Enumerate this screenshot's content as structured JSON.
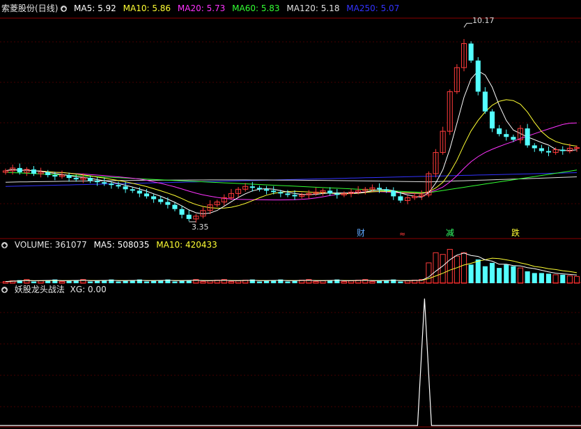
{
  "colors": {
    "bg": "#000000",
    "up": "#ff3b3b",
    "down": "#54ffff",
    "ma5": "#ffffff",
    "ma10": "#ffff33",
    "ma20": "#ff33ff",
    "ma60": "#33ff33",
    "ma120": "#e0e0e0",
    "ma250": "#3333ff",
    "grid": "#8b0000"
  },
  "price_panel": {
    "stock_name": "索菱股份",
    "period": "(日线)",
    "ma": [
      {
        "label": "MA5: 5.92",
        "color": "#ffffff"
      },
      {
        "label": "MA10: 5.86",
        "color": "#ffff33"
      },
      {
        "label": "MA20: 5.73",
        "color": "#ff33ff"
      },
      {
        "label": "MA60: 5.83",
        "color": "#33ff33"
      },
      {
        "label": "MA120: 5.18",
        "color": "#e0e0e0"
      },
      {
        "label": "MA250: 5.07",
        "color": "#3333ff"
      }
    ],
    "high_label": "10.17",
    "low_label": "3.35",
    "markers": [
      {
        "text": "财",
        "color": "#5fa8ff"
      },
      {
        "text": "≈",
        "color": "#ff3b3b"
      },
      {
        "text": "减",
        "color": "#33ff66"
      },
      {
        "text": "跌",
        "color": "#ffff33"
      }
    ]
  },
  "volume_panel": {
    "title": "VOLUME: 361077",
    "ma5": "MA5: 508035",
    "ma10": "MA10: 420433"
  },
  "indicator_panel": {
    "title": "妖股龙头战法",
    "value": "XG: 0.00"
  },
  "chart_data": {
    "type": "candlestick",
    "price_range": [
      3.35,
      10.17
    ],
    "closes": [
      5.1,
      5.2,
      5.05,
      5.15,
      5.0,
      5.05,
      4.95,
      4.9,
      4.95,
      4.85,
      4.8,
      4.85,
      4.75,
      4.7,
      4.65,
      4.6,
      4.55,
      4.45,
      4.4,
      4.3,
      4.2,
      4.1,
      4.0,
      3.9,
      3.75,
      3.55,
      3.4,
      3.5,
      3.7,
      3.9,
      4.0,
      4.15,
      4.3,
      4.45,
      4.55,
      4.5,
      4.45,
      4.4,
      4.35,
      4.3,
      4.25,
      4.2,
      4.25,
      4.3,
      4.35,
      4.4,
      4.3,
      4.25,
      4.3,
      4.35,
      4.4,
      4.45,
      4.5,
      4.45,
      4.4,
      4.2,
      4.05,
      4.15,
      4.2,
      4.25,
      5.0,
      5.75,
      6.5,
      7.9,
      8.75,
      9.6,
      9.0,
      7.9,
      7.2,
      6.6,
      6.4,
      6.3,
      6.2,
      6.6,
      6.0,
      5.9,
      5.8,
      5.75,
      5.85,
      5.8,
      5.9,
      5.92
    ],
    "xg_signal_index": 60
  }
}
